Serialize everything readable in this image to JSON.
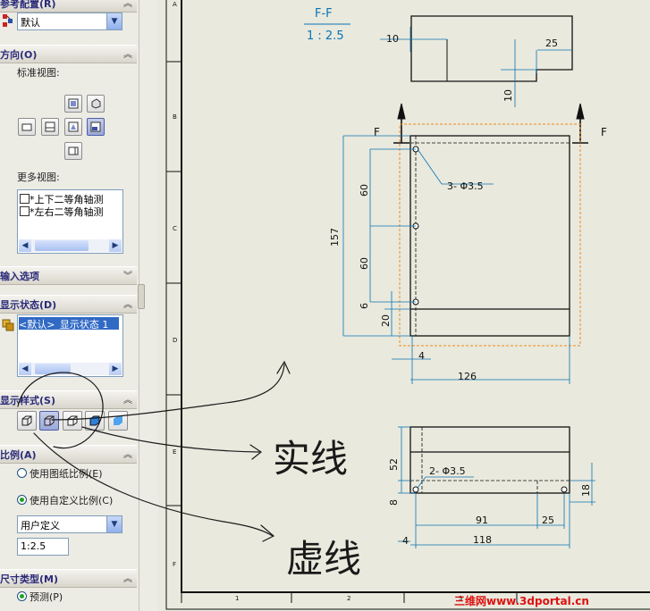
{
  "panel": {
    "ref_config": {
      "title": "参考配置(R)",
      "value": "默认"
    },
    "orientation": {
      "title": "方向(O)",
      "standard_views_label": "标准视图:",
      "more_views_label": "更多视图:",
      "more_views": [
        "*上下二等角轴测",
        "*左右二等角轴测"
      ]
    },
    "input_options": {
      "title": "输入选项"
    },
    "display_state": {
      "title": "显示状态(D)",
      "item": "<默认>_显示状态 1"
    },
    "display_style": {
      "title": "显示样式(S)"
    },
    "scale": {
      "title": "比例(A)",
      "option_sheet": "使用图纸比例(E)",
      "option_custom": "使用自定义比例(C)",
      "custom_type": "用户定义",
      "custom_value": "1:2.5"
    },
    "dim_type": {
      "title": "尺寸类型(M)",
      "option": "预测(P)"
    }
  },
  "drawing": {
    "section_label": "F-F",
    "section_scale": "1 : 2.5",
    "cut_label_left": "F",
    "cut_label_right": "F",
    "dims": {
      "top_10a": "10",
      "top_25": "25",
      "top_10b": "10",
      "hole_note_front": "3- Φ3.5",
      "d157": "157",
      "d60a": "60",
      "d60b": "60",
      "d6": "6",
      "d20": "20",
      "d4a": "4",
      "d126": "126",
      "d52": "52",
      "hole_note_bottom": "2- Φ3.5",
      "d8": "8",
      "d18": "18",
      "d91": "91",
      "d25b": "25",
      "d4b": "4",
      "d118": "118"
    },
    "border_rows": [
      "A",
      "B",
      "C",
      "D",
      "E",
      "F"
    ],
    "border_cols": [
      "1",
      "2",
      "3"
    ],
    "annotation_solid": "实线",
    "annotation_hidden": "虚线",
    "watermark": "三维网www.3dportal.cn"
  },
  "colors": {
    "dimension": "#0a73b5",
    "bounding_box": "#f08a1c",
    "annotation": "#1a1a1a",
    "watermark": "#dd1111"
  }
}
